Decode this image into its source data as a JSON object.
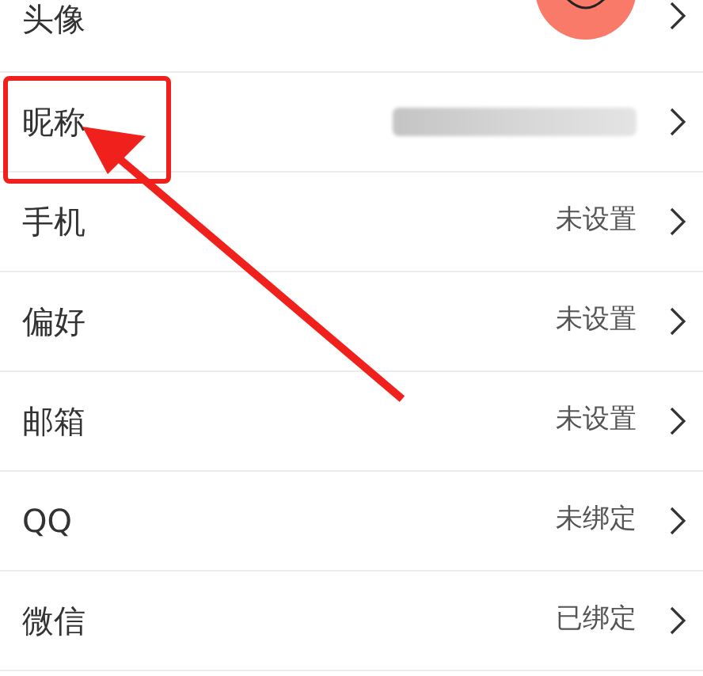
{
  "rows": [
    {
      "label": "头像",
      "kind": "avatar",
      "highlighted": false
    },
    {
      "label": "昵称",
      "kind": "blurred",
      "highlighted": true
    },
    {
      "label": "手机",
      "kind": "text",
      "value": "未设置",
      "highlighted": false
    },
    {
      "label": "偏好",
      "kind": "text",
      "value": "未设置",
      "highlighted": false
    },
    {
      "label": "邮箱",
      "kind": "text",
      "value": "未设置",
      "highlighted": false
    },
    {
      "label": "QQ",
      "kind": "text",
      "value": "未绑定",
      "highlighted": false
    },
    {
      "label": "微信",
      "kind": "text",
      "value": "已绑定",
      "highlighted": false
    }
  ]
}
